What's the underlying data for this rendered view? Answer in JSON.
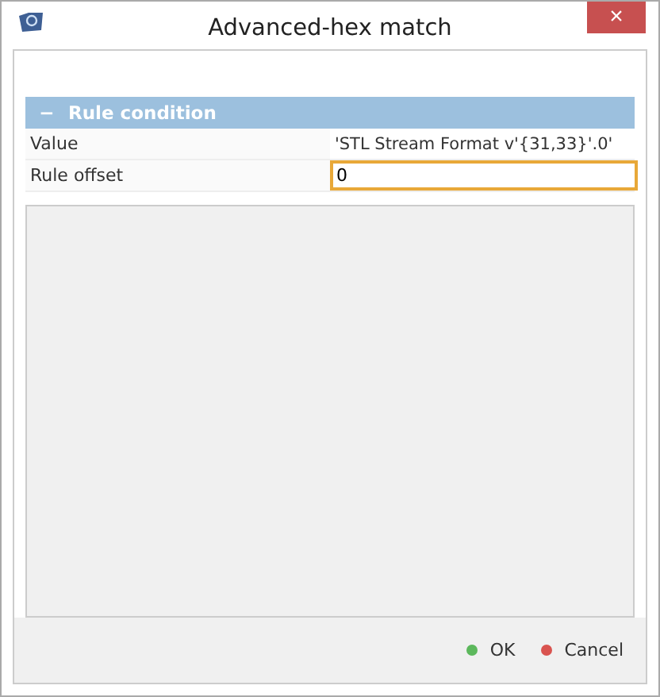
{
  "window": {
    "title": "Advanced-hex match",
    "close": "×"
  },
  "section": {
    "title": "Rule condition",
    "toggle": "−",
    "expanded": true
  },
  "properties": [
    {
      "label": "Value",
      "kind": "text",
      "value": "'STL Stream Format v'{31,33}'.0'"
    },
    {
      "label": "Rule offset",
      "kind": "input",
      "value": "0"
    }
  ],
  "buttons": [
    {
      "label": "OK",
      "color": "#5cb85c"
    },
    {
      "label": "Cancel",
      "color": "#d9534f"
    }
  ]
}
